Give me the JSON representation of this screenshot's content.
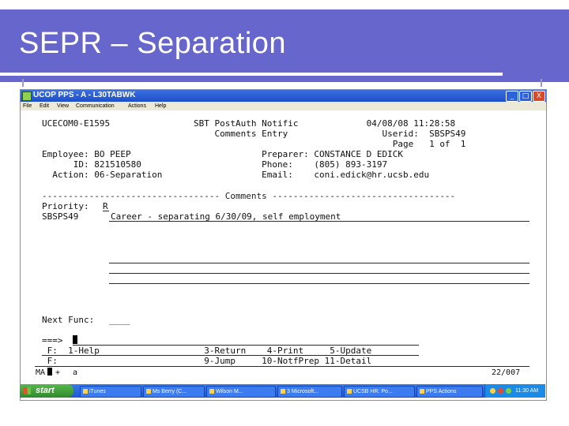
{
  "slide": {
    "title": "SEPR – Separation"
  },
  "window": {
    "title": "UCOP PPS - A - L30TABWK",
    "minimize": "_",
    "maximize": "□",
    "close": "X",
    "menu": [
      "File",
      "Edit",
      "View",
      "Communication",
      "Actions",
      "Help"
    ]
  },
  "screen": {
    "line1": "UCECOM0-E1595                SBT PostAuth Notific             04/08/08 11:28:58",
    "line2": "                                 Comments Entry                  Userid:  SBSPS49",
    "line3": "                                                                   Page   1 of  1",
    "line4": "Employee: BO PEEP                         Preparer: CONSTANCE D EDICK",
    "line5": "      ID: 821510580                       Phone:    (805) 893-3197",
    "line6": "  Action: 06-Separation                   Email:    coni.edick@hr.ucsb.edu",
    "separator": "---------------------------------- Comments -----------------------------------",
    "priority_label": "Priority:",
    "priority_value": "R",
    "comment_user": "SBSPS49",
    "comment_text": "Career - separating 6/30/09, self employment",
    "next_func_label": "Next Func:",
    "next_func_value": "____",
    "command_prompt": "===>",
    "fkeys1": " F:  1-Help                    3-Return    4-Print     5-Update",
    "fkeys2": " F:                            9-Jump     10-NotfPrep 11-Detail",
    "status_left": "MA",
    "status_plus": "+",
    "status_a": "a",
    "status_right": "22/007"
  },
  "taskbar": {
    "start": "start",
    "items": [
      "iTunes",
      "Ms Berry (C...",
      "Wilson M...",
      "3 Microsoft...",
      "UCSB HR: Po...",
      "PPS Actions"
    ],
    "clock": "11:30 AM"
  }
}
